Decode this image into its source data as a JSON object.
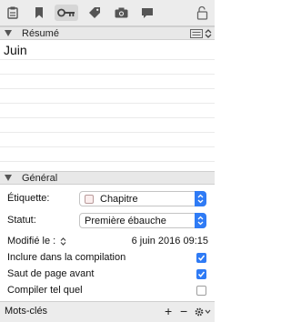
{
  "toolbar": {
    "icons": [
      "notes-icon",
      "bookmark-icon",
      "metadata-key-icon",
      "tag-icon",
      "snapshot-camera-icon",
      "comments-icon"
    ],
    "active": "metadata-key-icon",
    "lock_icon": "lock-icon"
  },
  "summary": {
    "header": "Résumé",
    "text": "Juin"
  },
  "general": {
    "header": "Général",
    "label_field": {
      "label": "Étiquette:",
      "value": "Chapitre",
      "swatch_color": "#fbeeee"
    },
    "status_field": {
      "label": "Statut:",
      "value": "Première ébauche"
    },
    "modified": {
      "label": "Modifié le :",
      "value": "6 juin 2016 09:15"
    },
    "options": [
      {
        "label": "Inclure dans la compilation",
        "checked": true
      },
      {
        "label": "Saut de page avant",
        "checked": true
      },
      {
        "label": "Compiler tel quel",
        "checked": false
      }
    ]
  },
  "keywords": {
    "header": "Mots-clés",
    "add": "+",
    "remove": "−"
  },
  "colors": {
    "accent": "#2f7bf5",
    "header_bg": "#e8e8e8"
  }
}
